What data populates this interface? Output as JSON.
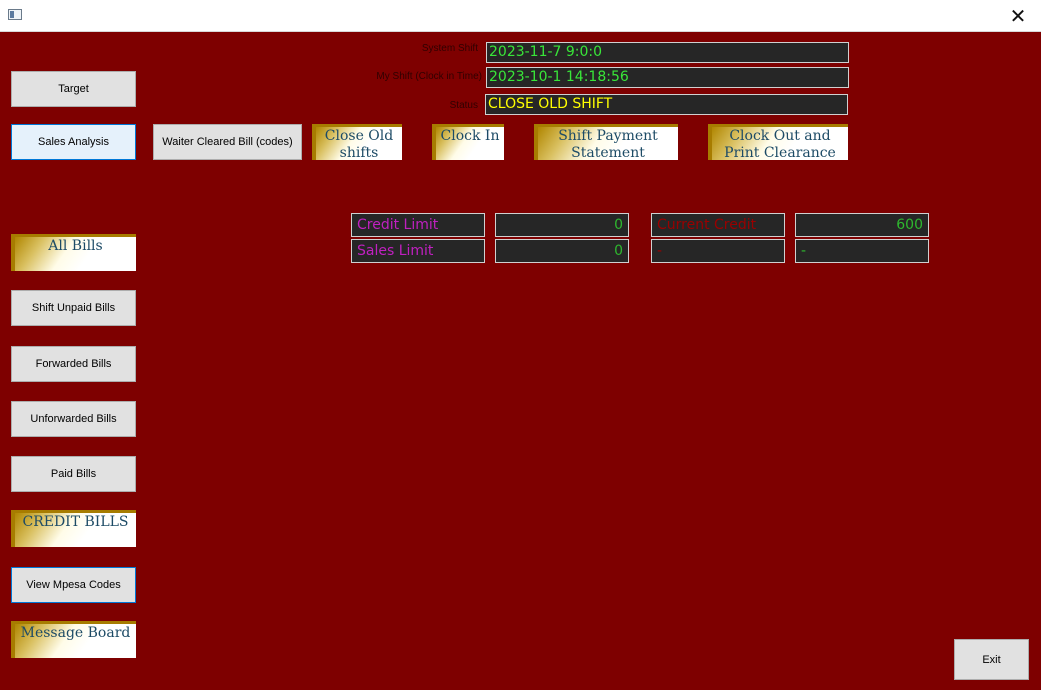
{
  "window": {
    "close_glyph": "✕"
  },
  "shift_info": {
    "system_shift_label": "System Shift",
    "system_shift_value": "2023-11-7 9:0:0",
    "my_shift_label": "My Shift (Clock in Time)",
    "my_shift_value": "2023-10-1 14:18:56",
    "status_label": "Status",
    "status_value": "CLOSE OLD SHIFT"
  },
  "top_buttons": {
    "waiter_cleared": "Waiter Cleared Bill (codes)",
    "close_old_shifts": "Close Old shifts",
    "clock_in": "Clock In",
    "shift_payment": "Shift Payment Statement",
    "clock_out": "Clock Out and Print Clearance Slip"
  },
  "sidebar": {
    "target": "Target",
    "sales_analysis": "Sales Analysis",
    "all_bills": "All Bills",
    "shift_unpaid": "Shift Unpaid Bills",
    "forwarded": "Forwarded Bills",
    "unforwarded": "Unforwarded Bills",
    "paid": "Paid Bills",
    "credit_bills": "CREDIT BILLS",
    "view_mpesa": "View Mpesa Codes",
    "message_board": "Message Board"
  },
  "limits": {
    "credit_limit_label": "Credit Limit",
    "credit_limit_value": "0",
    "current_credit_label": "Current Credit",
    "current_credit_value": "600",
    "sales_limit_label": "Sales Limit",
    "sales_limit_value": "0",
    "blank_1": "-",
    "blank_2": "-"
  },
  "footer": {
    "exit": "Exit"
  },
  "colors": {
    "background": "#7e0000",
    "field_bg": "#262626",
    "field_green": "#39e639",
    "status_yellow": "#ffff00",
    "label_purple": "#c020c0",
    "gold_accent": "#a77c00"
  }
}
